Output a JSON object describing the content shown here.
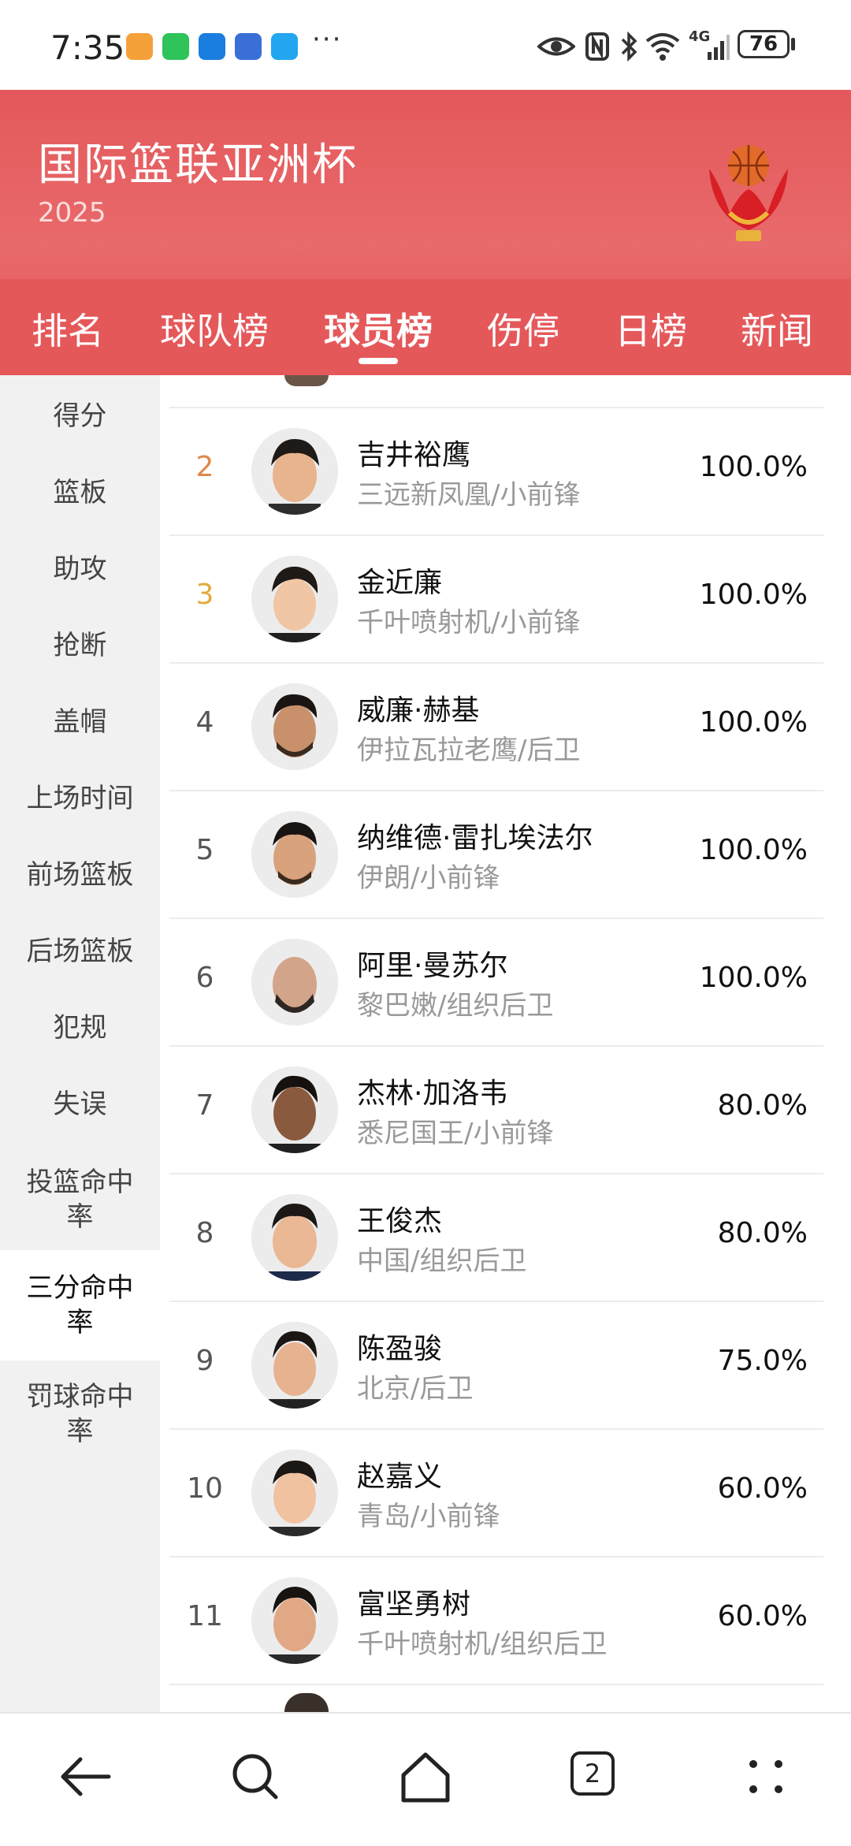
{
  "status_bar": {
    "time": "7:35",
    "overflow": "···",
    "network": "4G",
    "battery": "76"
  },
  "header": {
    "title": "国际篮联亚洲杯",
    "year": "2025",
    "logo_icon": "trophy-icon"
  },
  "tabs": [
    {
      "label": "排名"
    },
    {
      "label": "球队榜"
    },
    {
      "label": "球员榜"
    },
    {
      "label": "伤停"
    },
    {
      "label": "日榜"
    },
    {
      "label": "新闻"
    }
  ],
  "active_tab": "球员榜",
  "categories": [
    {
      "label": "得分"
    },
    {
      "label": "篮板"
    },
    {
      "label": "助攻"
    },
    {
      "label": "抢断"
    },
    {
      "label": "盖帽"
    },
    {
      "label": "上场时间"
    },
    {
      "label": "前场篮板"
    },
    {
      "label": "后场篮板"
    },
    {
      "label": "犯规"
    },
    {
      "label": "失误"
    },
    {
      "label": "投篮命中率"
    },
    {
      "label": "三分命中率"
    },
    {
      "label": "罚球命中率"
    }
  ],
  "active_category": "三分命中率",
  "players": [
    {
      "rank": "2",
      "name": "吉井裕鹰",
      "team": "三远新凤凰/小前锋",
      "value": "100.0%"
    },
    {
      "rank": "3",
      "name": "金近廉",
      "team": "千叶喷射机/小前锋",
      "value": "100.0%"
    },
    {
      "rank": "4",
      "name": "威廉·赫基",
      "team": "伊拉瓦拉老鹰/后卫",
      "value": "100.0%"
    },
    {
      "rank": "5",
      "name": "纳维德·雷扎埃法尔",
      "team": "伊朗/小前锋",
      "value": "100.0%"
    },
    {
      "rank": "6",
      "name": "阿里·曼苏尔",
      "team": "黎巴嫩/组织后卫",
      "value": "100.0%"
    },
    {
      "rank": "7",
      "name": "杰林·加洛韦",
      "team": "悉尼国王/小前锋",
      "value": "80.0%"
    },
    {
      "rank": "8",
      "name": "王俊杰",
      "team": "中国/组织后卫",
      "value": "80.0%"
    },
    {
      "rank": "9",
      "name": "陈盈骏",
      "team": "北京/后卫",
      "value": "75.0%"
    },
    {
      "rank": "10",
      "name": "赵嘉义",
      "team": "青岛/小前锋",
      "value": "60.0%"
    },
    {
      "rank": "11",
      "name": "富坚勇树",
      "team": "千叶喷射机/组织后卫",
      "value": "60.0%"
    }
  ],
  "colors": {
    "brand_red": "#e5585a",
    "rank_2": "#e0874a",
    "rank_3": "#e3a93a"
  },
  "nav": {
    "tab_count": "2"
  }
}
